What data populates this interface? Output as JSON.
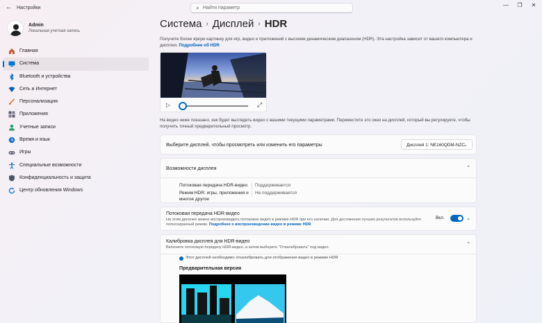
{
  "window": {
    "back_icon": "back-arrow-icon",
    "title": "Настройки",
    "search_placeholder": "Найти параметр",
    "controls": [
      "—",
      "❐",
      "✕"
    ]
  },
  "profile": {
    "name": "Admin",
    "account_type": "Локальная учетная запись"
  },
  "sidebar": {
    "items": [
      {
        "label": "Главная",
        "icon": "home-icon",
        "color": "#c35b2e"
      },
      {
        "label": "Система",
        "icon": "system-display-icon",
        "color": "#0078d4",
        "active": true
      },
      {
        "label": "Bluetooth и устройства",
        "icon": "bluetooth-icon",
        "color": "#0067c0"
      },
      {
        "label": "Сеть и Интернет",
        "icon": "network-icon",
        "color": "#0a5fb4"
      },
      {
        "label": "Персонализация",
        "icon": "brush-icon",
        "color": "#d9822b"
      },
      {
        "label": "Приложения",
        "icon": "apps-icon",
        "color": "#5a5a6e"
      },
      {
        "label": "Учетные записи",
        "icon": "account-icon",
        "color": "#2e9a6a"
      },
      {
        "label": "Время и язык",
        "icon": "globe-clock-icon",
        "color": "#1a73c8"
      },
      {
        "label": "Игры",
        "icon": "gamepad-icon",
        "color": "#6b6b7b"
      },
      {
        "label": "Специальные возможности",
        "icon": "accessibility-icon",
        "color": "#1a6fb5"
      },
      {
        "label": "Конфиденциальность и защита",
        "icon": "shield-icon",
        "color": "#4a5568"
      },
      {
        "label": "Центр обновления Windows",
        "icon": "update-icon",
        "color": "#0a6ed1"
      }
    ]
  },
  "breadcrumb": {
    "items": [
      "Система",
      "Дисплей",
      "HDR"
    ],
    "separator": "›"
  },
  "intro": {
    "text": "Получите более яркую картинку для игр, видео и приложений с высоким динамическим диапазоном (HDR). Эта настройка зависит от вашего компьютера и дисплея.",
    "link": "Подробнее об HDR"
  },
  "video_player": {
    "play_icon": "play-icon",
    "expand_icon": "expand-icon",
    "progress": 0.0
  },
  "video_note": "На видео ниже показано, как будет выглядеть видео с вашими текущими параметрами. Переместите это окно на дисплей, который вы регулируете, чтобы получить точный предварительный просмотр.",
  "display_select": {
    "label": "Выберите дисплей, чтобы просмотреть или изменить его параметры",
    "value": "Дисплей 1: NE160QDM-NZC"
  },
  "capabilities": {
    "title": "Возможности дисплея",
    "rows": [
      {
        "label": "Потоковая передача HDR-видео",
        "value": "Поддерживается"
      },
      {
        "label": "Режим HDR: игры, приложения и многое другое",
        "value": "Не поддерживается"
      }
    ]
  },
  "hdr_streaming": {
    "title": "Потоковая передача HDR-видео",
    "desc": "На этом дисплее можно воспроизводить потоковое видео в режиме HDR при его наличии. Для достижения лучших результатов используйте полноэкранный режим.",
    "link": "Подробнее о воспроизведении видео в режиме HDR",
    "toggle_label": "Вкл.",
    "toggle_on": true
  },
  "calibration": {
    "title": "Калибровка дисплея для HDR-видео",
    "desc": "Включите потоковую передачу HDR-видео, а затем выберите \"Откалибровать\" под видео.",
    "info": "Этот дисплей необходимо откалибровать для отображения видео в режиме HDR",
    "preview_label": "Предварительная версия"
  }
}
